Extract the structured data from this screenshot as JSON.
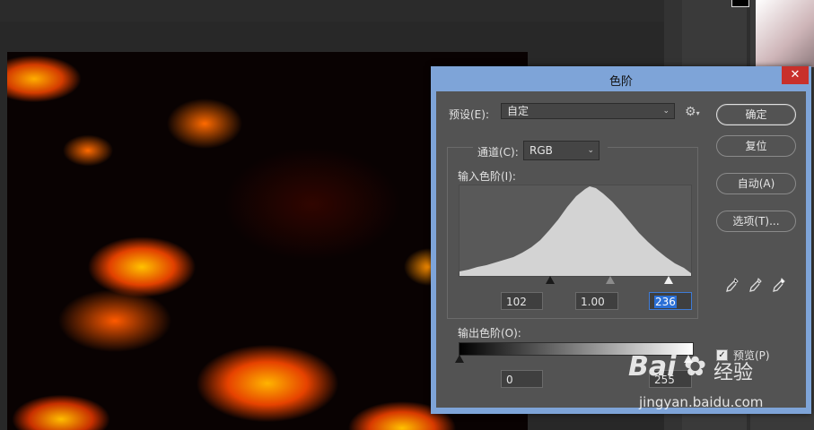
{
  "dialog": {
    "title": "色阶",
    "close_glyph": "✕",
    "preset_label": "预设(E):",
    "preset_value": "自定",
    "channel_label": "通道(C):",
    "channel_value": "RGB",
    "input_levels_label": "输入色阶(I):",
    "input_black": "102",
    "input_gamma": "1.00",
    "input_white": "236",
    "output_levels_label": "输出色阶(O):",
    "output_black": "0",
    "output_white": "255",
    "buttons": {
      "ok": "确定",
      "reset": "复位",
      "auto": "自动(A)",
      "options": "选项(T)..."
    },
    "preview_label": "预览(P)",
    "preview_checked": true
  },
  "icons": {
    "gear": "gear-icon",
    "dropdown": "chevron-down-icon",
    "eyedroppers": [
      "black-eyedropper-icon",
      "gray-eyedropper-icon",
      "white-eyedropper-icon"
    ]
  },
  "watermark": {
    "brand": "Bai",
    "brand2": "经验",
    "url": "jingyan.baidu.com"
  }
}
